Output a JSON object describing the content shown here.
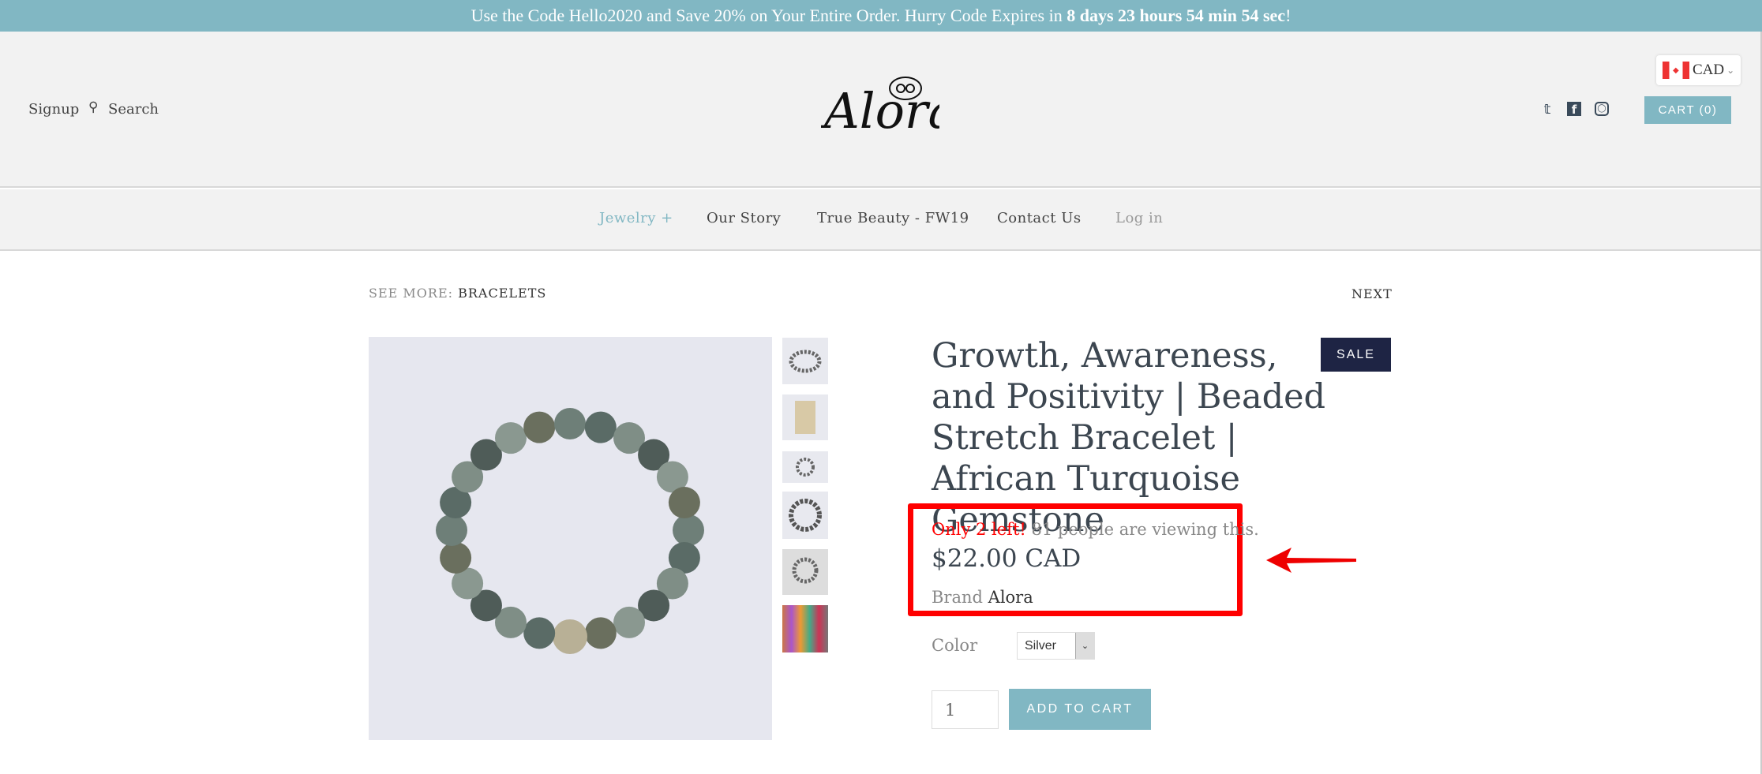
{
  "banner": {
    "prefix": "Use the Code Hello2020 and Save 20% on Your Entire Order. Hurry Code Expires in ",
    "countdown": "8 days 23 hours 54 min 54 sec",
    "suffix": "!"
  },
  "header": {
    "signup": "Signup",
    "search": "Search",
    "logo": "Alora",
    "currency": "CAD",
    "cart": "CART (0)",
    "social": [
      "twitter-icon",
      "facebook-icon",
      "instagram-icon"
    ]
  },
  "nav": {
    "items": [
      "Jewelry +",
      "Our Story",
      "True Beauty - FW19",
      "Contact Us",
      "Log in"
    ]
  },
  "breadcrumb": {
    "label": "SEE MORE:",
    "link": "BRACELETS",
    "next": "NEXT"
  },
  "product": {
    "title": "Growth, Awareness, and Positivity | Beaded Stretch Bracelet | African Turquoise Gemstone",
    "badge": "SALE",
    "stock": "Only 2 left!",
    "viewers": "81 people are viewing this.",
    "price": "$22.00 CAD",
    "brand_label": "Brand",
    "brand": "Alora",
    "color_label": "Color",
    "color_value": "Silver",
    "quantity": "1",
    "add_to_cart": "ADD TO CART"
  },
  "colors": {
    "accent": "#81b7c3",
    "sale": "#1e2444",
    "alert": "#ff0000"
  }
}
